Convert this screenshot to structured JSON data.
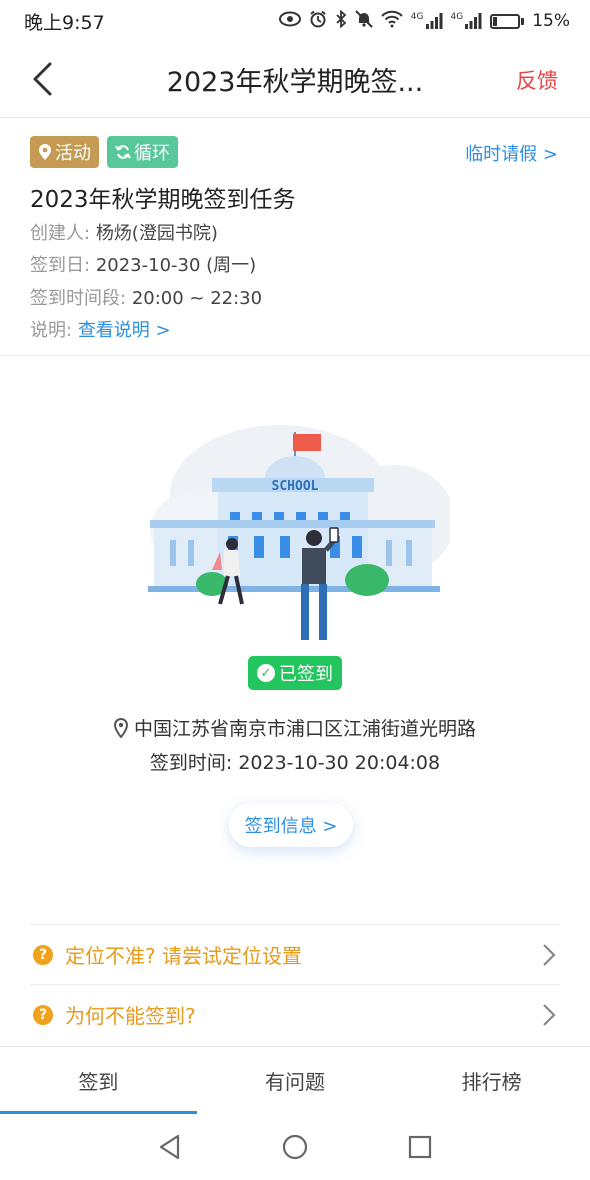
{
  "status_bar": {
    "time": "晚上9:57",
    "net_label_1": "4G",
    "net_label_2": "4G",
    "battery": "15%",
    "battery_level": 0.15
  },
  "header": {
    "title": "2023年秋学期晚签...",
    "feedback": "反馈"
  },
  "tags": {
    "activity": "活动",
    "cycle": "循环"
  },
  "leave_link": "临时请假 >",
  "task": {
    "title": "2023年秋学期晚签到任务",
    "creator_label": "创建人:",
    "creator": "杨炀(澄园书院)",
    "date_label": "签到日:",
    "date": "2023-10-30 (周一)",
    "period_label": "签到时间段:",
    "period": "20:00 ~ 22:30",
    "desc_label": "说明:",
    "desc_link": "查看说明 >"
  },
  "illustration": {
    "school_text": "SCHOOL"
  },
  "signed_badge": "已签到",
  "location": "中国江苏省南京市浦口区江浦街道光明路",
  "sign_time": "签到时间: 2023-10-30 20:04:08",
  "sign_info_button": "签到信息 >",
  "help": {
    "location_help": "定位不准? 请尝试定位设置",
    "why_cannot": "为何不能签到?"
  },
  "tabs": [
    "签到",
    "有问题",
    "排行榜"
  ],
  "colors": {
    "accent": "#2f8fdf",
    "signed_green": "#22c55e",
    "warning": "#f0a21c",
    "feedback_red": "#e54545",
    "tag_activity": "#c59a52",
    "tag_cycle": "#58c79a"
  }
}
